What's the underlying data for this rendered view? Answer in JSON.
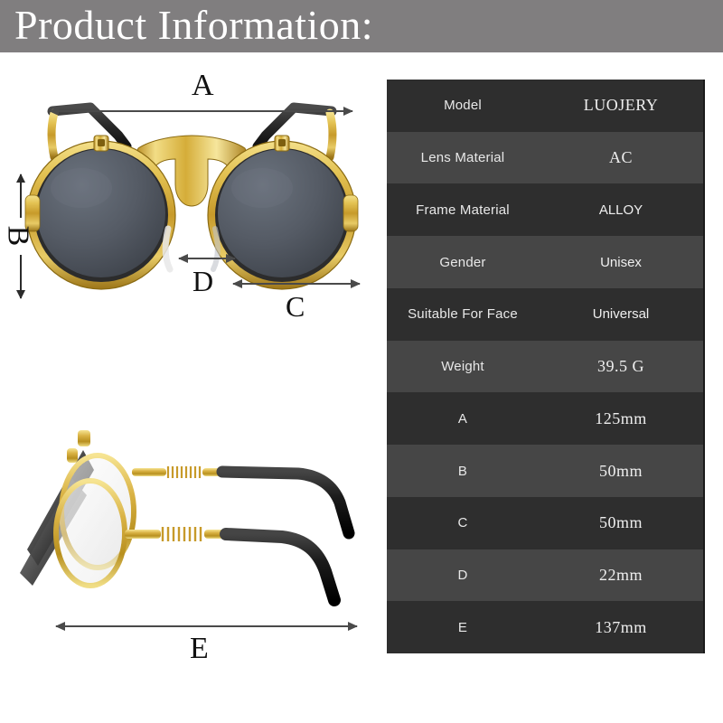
{
  "header": {
    "title": "Product Information:",
    "background_color": "#807e7f",
    "text_color": "#ffffff"
  },
  "figure": {
    "front_view": {
      "name": "front-view-sunglasses",
      "description": "Round gold metal frame flip-up sunglasses, front view, dark gray tinted lenses, black temple arms folded upward",
      "frame_color": "#d9ad3a",
      "lens_color": "#545a63",
      "temple_color": "#2b2b2b"
    },
    "side_view": {
      "name": "side-view-sunglasses",
      "description": "Side profile of round flip-up sunglasses showing spring coil hinges, gold temples and black temple tips",
      "frame_color": "#d9ad3a",
      "temple_tip_color": "#15150f"
    },
    "dimension_labels": [
      {
        "id": "A",
        "label": "A",
        "orientation": "horizontal",
        "view": "front",
        "measures": "total frame width"
      },
      {
        "id": "B",
        "label": "B",
        "orientation": "vertical",
        "view": "front",
        "measures": "lens height"
      },
      {
        "id": "C",
        "label": "C",
        "orientation": "horizontal",
        "view": "front",
        "measures": "lens width"
      },
      {
        "id": "D",
        "label": "D",
        "orientation": "horizontal",
        "view": "front",
        "measures": "bridge width"
      },
      {
        "id": "E",
        "label": "E",
        "orientation": "horizontal",
        "view": "side",
        "measures": "temple arm length"
      }
    ]
  },
  "spec_table": {
    "row_color_odd": "#2e2e2e",
    "row_color_even": "#464646",
    "rows": [
      {
        "label": "Model",
        "value": "LUOJERY",
        "value_style": "serif"
      },
      {
        "label": "Lens Material",
        "value": "AC",
        "value_style": "serif"
      },
      {
        "label": "Frame Material",
        "value": "ALLOY",
        "value_style": "sans"
      },
      {
        "label": "Gender",
        "value": "Unisex",
        "value_style": "sans"
      },
      {
        "label": "Suitable For Face",
        "value": "Universal",
        "value_style": "sans"
      },
      {
        "label": "Weight",
        "value": "39.5 G",
        "value_style": "serif"
      },
      {
        "label": "A",
        "value": "125mm",
        "value_style": "serif"
      },
      {
        "label": "B",
        "value": "50mm",
        "value_style": "serif"
      },
      {
        "label": "C",
        "value": "50mm",
        "value_style": "serif"
      },
      {
        "label": "D",
        "value": "22mm",
        "value_style": "serif"
      },
      {
        "label": "E",
        "value": "137mm",
        "value_style": "serif"
      }
    ]
  }
}
